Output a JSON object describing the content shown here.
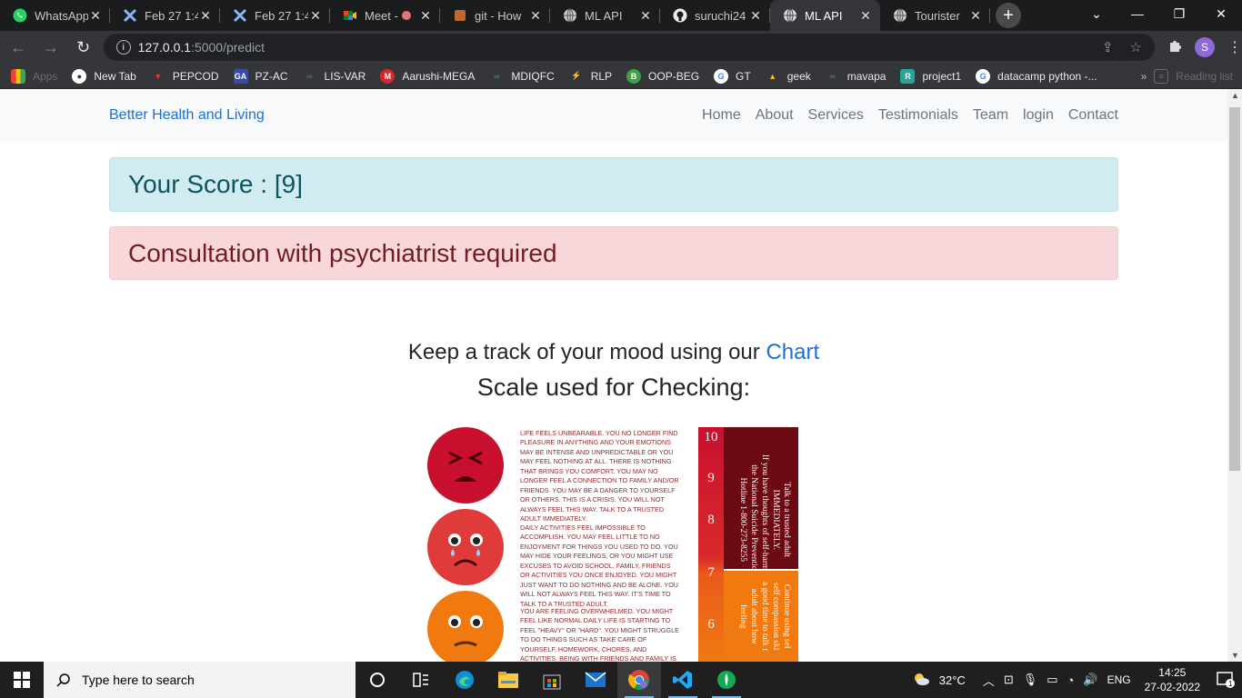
{
  "browser": {
    "tabs": [
      {
        "title": "WhatsApp",
        "icon": "whatsapp-icon",
        "active": false
      },
      {
        "title": "Feb 27 1:4",
        "icon": "zoom-x-icon",
        "active": false
      },
      {
        "title": "Feb 27 1:4",
        "icon": "zoom-x-icon",
        "active": false
      },
      {
        "title": "Meet -",
        "icon": "google-meet-icon",
        "active": false
      },
      {
        "title": "git - How",
        "icon": "git-icon",
        "active": false
      },
      {
        "title": "ML API",
        "icon": "globe-icon",
        "active": false
      },
      {
        "title": "suruchi24",
        "icon": "github-icon",
        "active": false
      },
      {
        "title": "ML API",
        "icon": "globe-icon",
        "active": true
      },
      {
        "title": "Tourister",
        "icon": "globe-icon",
        "active": false
      }
    ],
    "url_host": "127.0.0.1",
    "url_path": ":5000/predict",
    "profile_initial": "S",
    "bookmarks": [
      {
        "label": "Apps",
        "icon": "apps-grid-icon",
        "faint": true
      },
      {
        "label": "New Tab",
        "icon": "globe-icon"
      },
      {
        "label": "PEPCOD",
        "icon": "pepcoding-icon"
      },
      {
        "label": "PZ-AC",
        "icon": "atcoder-icon"
      },
      {
        "label": "LIS-VAR",
        "icon": "gfg-icon"
      },
      {
        "label": "Aarushi-MEGA",
        "icon": "mega-icon"
      },
      {
        "label": "MDIQFC",
        "icon": "gfg-icon"
      },
      {
        "label": "RLP",
        "icon": "rlp-icon"
      },
      {
        "label": "OOP-BEG",
        "icon": "oop-icon"
      },
      {
        "label": "GT",
        "icon": "google-icon"
      },
      {
        "label": "geek",
        "icon": "drive-icon"
      },
      {
        "label": "mavapa",
        "icon": "gfg-icon"
      },
      {
        "label": "project1",
        "icon": "replit-icon"
      },
      {
        "label": "datacamp python -...",
        "icon": "google-icon"
      }
    ],
    "reading_list": "Reading list"
  },
  "site": {
    "brand": "Better Health and Living",
    "nav": [
      "Home",
      "About",
      "Services",
      "Testimonials",
      "Team",
      "login",
      "Contact"
    ],
    "score_text": "Your Score : [9]",
    "result_text": "Consultation with psychiatrist required",
    "track_prefix": "Keep a track of your mood using our ",
    "track_link": "Chart",
    "scale_heading": "Scale used for Checking:"
  },
  "scale_image": {
    "desc1": "LIFE FEELS UNBEARABLE. YOU NO LONGER FIND PLEASURE IN ANYTHING AND YOUR EMOTIONS MAY BE INTENSE AND UNPREDICTABLE OR YOU MAY FEEL NOTHING AT ALL. THERE IS NOTHING THAT BRINGS YOU COMFORT. YOU MAY NO LONGER FEEL A CONNECTION TO FAMILY AND/OR FRIENDS. YOU MAY BE A DANGER TO YOURSELF OR OTHERS. THIS IS A CRISIS. YOU WILL NOT ALWAYS FEEL THIS WAY. TALK TO A TRUSTED ADULT IMMEDIATELY.",
    "desc2": "DAILY ACTIVITIES FEEL IMPOSSIBLE TO ACCOMPLISH. YOU MAY FEEL LITTLE TO NO ENJOYMENT FOR THINGS YOU USED TO DO. YOU MAY HIDE YOUR FEELINGS, OR YOU MIGHT USE EXCUSES TO AVOID SCHOOL, FAMILY, FRIENDS OR ACTIVITIES YOU ONCE ENJOYED. YOU MIGHT JUST WANT TO DO NOTHING AND BE ALONE. YOU WILL NOT ALWAYS FEEL THIS WAY. IT'S TIME TO TALK TO A TRUSTED ADULT.",
    "desc3": "YOU ARE FEELING OVERWHELMED. YOU MIGHT FEEL LIKE NORMAL DAILY LIFE IS STARTING TO FEEL \"HEAVY\" OR \"HARD\". YOU MIGHT STRUGGLE TO DO THINGS SUCH AS TAKE CARE OF YOURSELF, HOMEWORK, CHORES, AND ACTIVITIES. BEING WITH FRIENDS AND FAMILY IS NOT AS ENJOYABLE AS IT ONCE",
    "numbers": [
      "10",
      "9",
      "8",
      "7",
      "6"
    ],
    "red_block_lines": [
      "Talk to a trusted adult",
      "IMMEDIATELY.",
      "If you have thoughts of self-harm call",
      "the National Suicide Prevention",
      "Hotline 1-800-273-8255"
    ],
    "orange_block_lines": [
      "Continue using sel",
      "self compassion ski",
      "a good time to talk t",
      "adult about how",
      "feeling"
    ],
    "colors": {
      "level10": "#c8102e",
      "level7": "#e95a1c",
      "dark_red": "#6b0a12",
      "orange": "#f07a10"
    }
  },
  "taskbar": {
    "search_placeholder": "Type here to search",
    "apps": [
      "task-view-icon",
      "widgets-icon",
      "edge-icon",
      "file-explorer-icon",
      "store-icon",
      "mail-icon",
      "chrome-icon",
      "vscode-icon",
      "mongodb-compass-icon"
    ],
    "weather": "32°C",
    "language": "ENG",
    "time": "14:25",
    "date": "27-02-2022",
    "notifications": "1"
  }
}
